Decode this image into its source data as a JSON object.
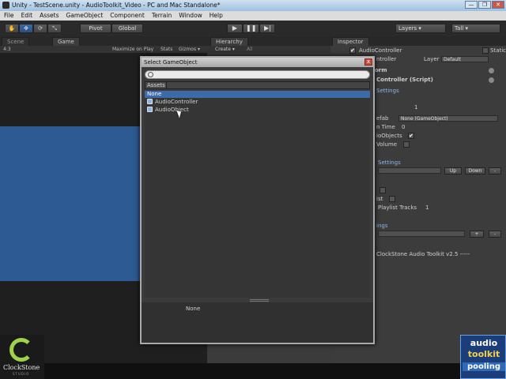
{
  "window": {
    "title": "Unity - TestScene.unity - AudioToolkit_Video - PC and Mac Standalone*",
    "min": "—",
    "max": "❐",
    "close": "✕"
  },
  "menu": [
    "File",
    "Edit",
    "Assets",
    "GameObject",
    "Component",
    "Terrain",
    "Window",
    "Help"
  ],
  "toolbar": {
    "pivot": "Pivot",
    "global": "Global",
    "play": "▶",
    "pause": "❚❚",
    "step": "▶|",
    "layers": "Layers",
    "layout": "Tall"
  },
  "scene_tabs": {
    "scene": "Scene",
    "game": "Game"
  },
  "game_bar": {
    "aspect": "4:3",
    "maximize": "Maximize on Play",
    "stats": "Stats",
    "gizmos": "Gizmos ▾"
  },
  "hierarchy": {
    "tab": "Hierarchy",
    "create": "Create ▾",
    "search": "All"
  },
  "inspector": {
    "tab": "Inspector",
    "object_name": "AudioController",
    "static": "Static",
    "tag_label": "ntroller",
    "layer_label": "Layer",
    "layer_value": "Default",
    "transform": "orm",
    "script": "Controller (Script)",
    "settings_header": "Settings",
    "volume_value": "1",
    "prefab_label": "efab",
    "prefab_value": "None (GameObject)",
    "time_label": "n Time",
    "time_value": "0",
    "objects_label": "ioObjects",
    "objects_check": "✔",
    "volume_label": "Volume",
    "settings2_header": "Settings",
    "up": "Up",
    "down": "Down",
    "minus": "-",
    "ist_label": "ist",
    "playlist_label": "Playlist Tracks",
    "playlist_value": "1",
    "rings_label": "ings",
    "plus": "+",
    "footer": "ClockStone Audio Toolkit v2.5 -----"
  },
  "dialog": {
    "title": "Select GameObject",
    "close": "x",
    "search_value": "",
    "filter": "Assets",
    "items": [
      "None",
      "AudioController",
      "AudioObject"
    ],
    "selected_index": 0,
    "preview_text": "None"
  },
  "logo_left": {
    "name": "ClockStone",
    "sub": "STUDIO"
  },
  "logo_right": {
    "line1": "audio",
    "line2": "toolkit",
    "line3": "pooling"
  }
}
